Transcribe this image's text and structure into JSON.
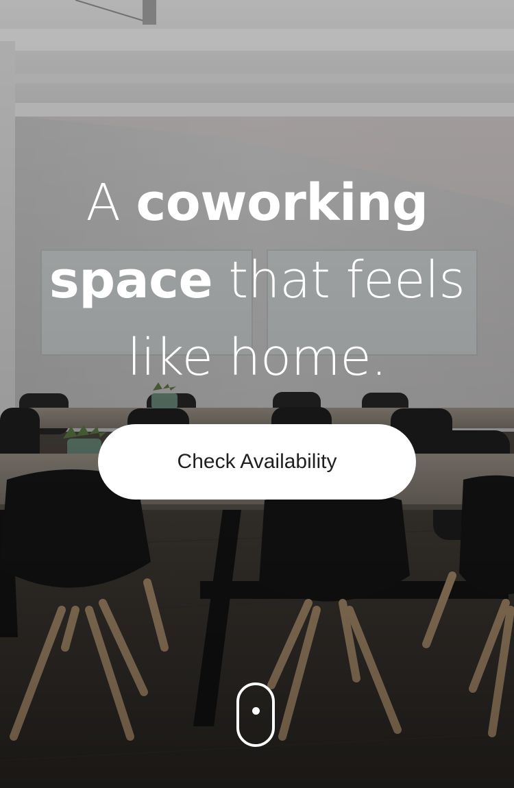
{
  "hero": {
    "headline": {
      "line1_plain": "A ",
      "line1_bold": "coworking",
      "line2_bold": "space",
      "line2_plain": " that feels",
      "line3_plain": "like home."
    },
    "cta_label": "Check Availability",
    "background_image": "coworking-meeting-room-photo",
    "scroll_icon": "mouse-scroll-icon"
  },
  "colors": {
    "headline_text": "#ffffff",
    "button_background": "#ffffff",
    "button_text": "#1f1f1f"
  }
}
